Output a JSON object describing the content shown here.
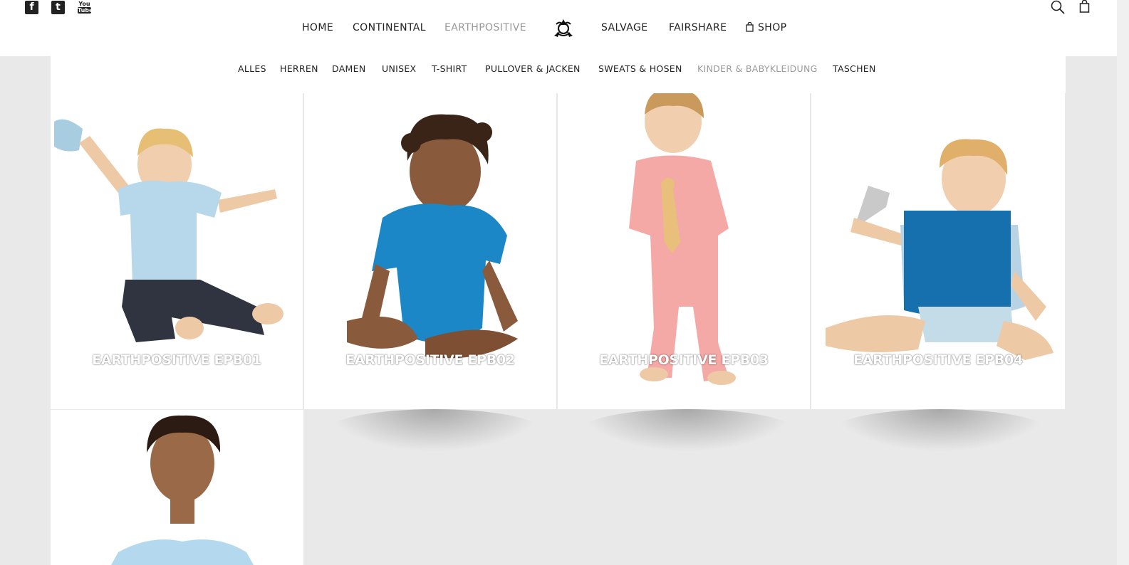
{
  "social": [
    {
      "icon": "facebook-icon",
      "glyph": "f"
    },
    {
      "icon": "twitter-icon",
      "glyph": "t"
    },
    {
      "icon": "youtube-icon",
      "top": "You",
      "bottom": "Tube"
    }
  ],
  "main_nav": {
    "home": "HOME",
    "continental": "CONTINENTAL",
    "earthpositive": "EARTHPOSITIVE",
    "salvage": "SALVAGE",
    "fairshare": "FAIRSHARE",
    "shop": "SHOP"
  },
  "sub_nav": {
    "alles": "ALLES",
    "herren": "HERREN",
    "damen": "DAMEN",
    "unisex": "UNISEX",
    "tshirt": "T-SHIRT",
    "pullover": "PULLOVER & JACKEN",
    "sweats": "SWEATS & HOSEN",
    "kinder": "KINDER & BABYKLEIDUNG",
    "taschen": "TASCHEN"
  },
  "products": [
    {
      "caption": "EARTHPOSITIVE EPB01",
      "shirt": "#b7d8ea"
    },
    {
      "caption": "EARTHPOSITIVE EPB02",
      "shirt": "#1b87c6"
    },
    {
      "caption": "EARTHPOSITIVE EPB03",
      "shirt": "#f4a9a6"
    },
    {
      "caption": "EARTHPOSITIVE EPB04",
      "shirt": "#1570ad"
    },
    {
      "caption": "",
      "shirt": "#b4d9ee"
    }
  ],
  "colors": {
    "active_nav": "#999999",
    "text": "#222222",
    "background": "#e9e9e9"
  }
}
